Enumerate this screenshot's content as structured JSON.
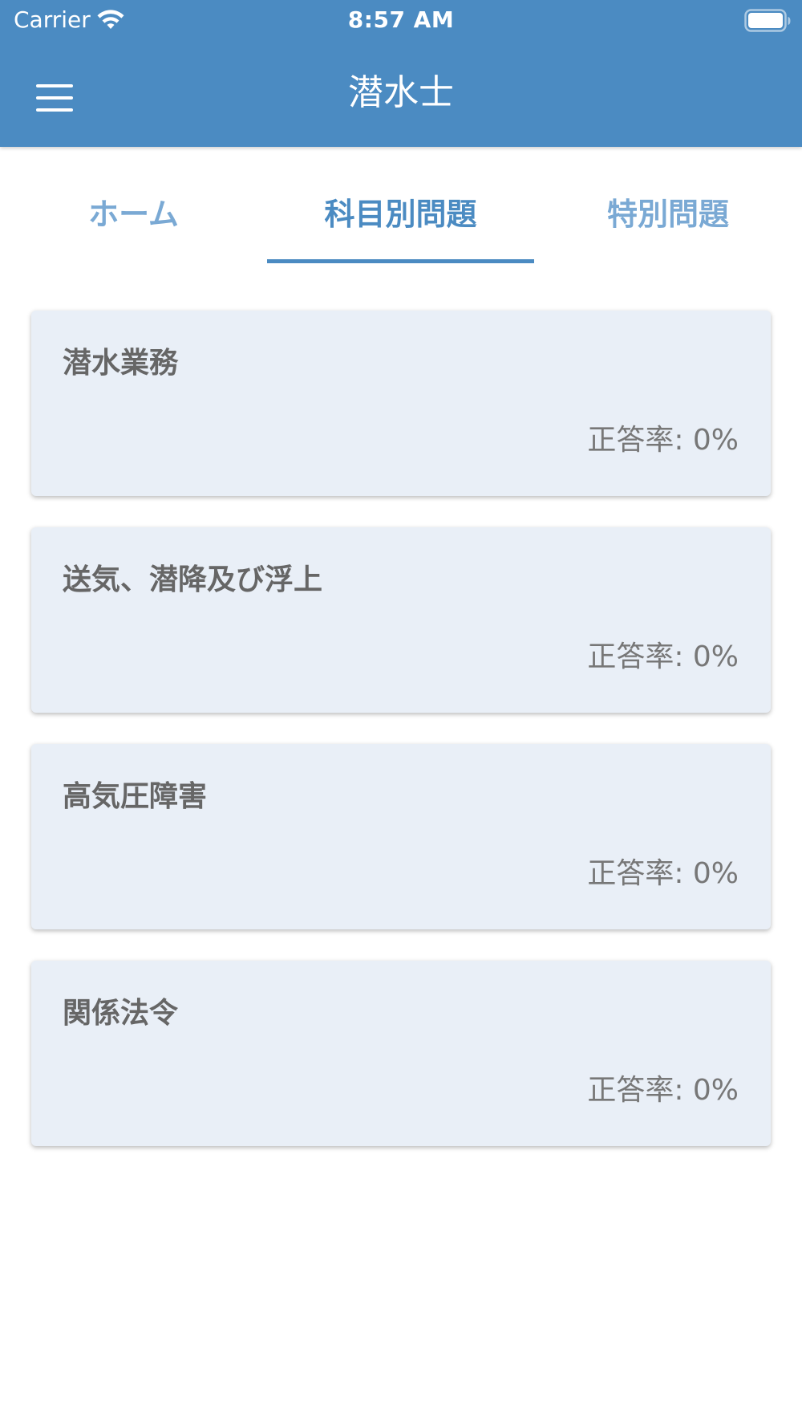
{
  "status_bar": {
    "carrier": "Carrier",
    "time": "8:57 AM"
  },
  "app_bar": {
    "title": "潜水士",
    "menu_icon": "hamburger-menu-icon"
  },
  "tabs": [
    {
      "label": "ホーム",
      "active": false
    },
    {
      "label": "科目別問題",
      "active": true
    },
    {
      "label": "特別問題",
      "active": false
    }
  ],
  "subjects": [
    {
      "title": "潜水業務",
      "rate": "正答率: 0%"
    },
    {
      "title": "送気、潜降及び浮上",
      "rate": "正答率: 0%"
    },
    {
      "title": "高気圧障害",
      "rate": "正答率: 0%"
    },
    {
      "title": "関係法令",
      "rate": "正答率: 0%"
    }
  ],
  "colors": {
    "primary": "#4b8bc2",
    "tab_inactive": "#7aa9d4",
    "card_background": "#e9eff7",
    "card_title": "#666666",
    "card_rate": "#777777"
  }
}
